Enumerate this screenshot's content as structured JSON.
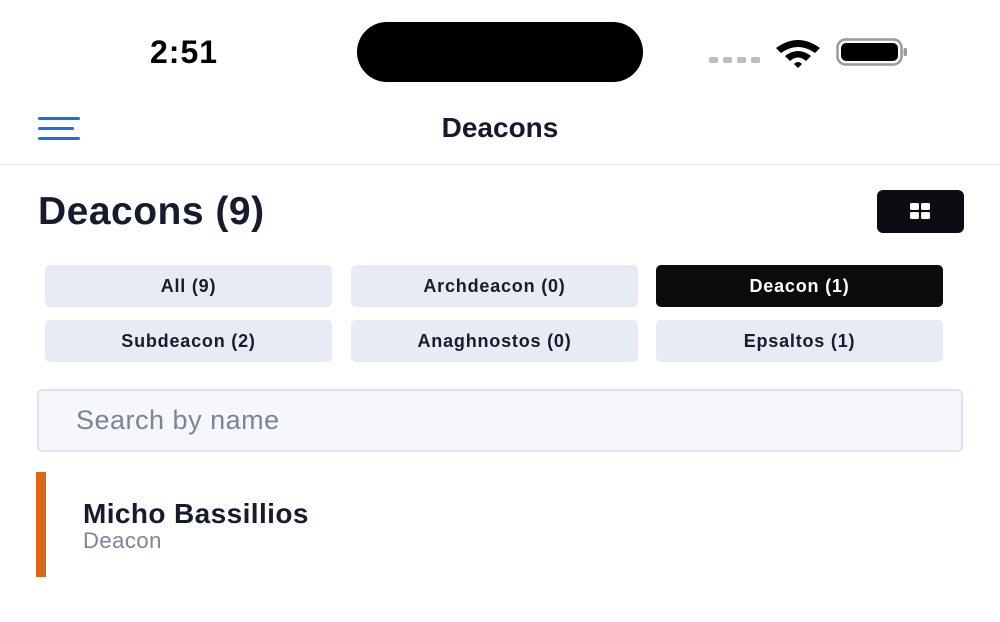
{
  "status_bar": {
    "time": "2:51"
  },
  "nav": {
    "title": "Deacons",
    "menu_icon": "hamburger-menu-icon"
  },
  "header": {
    "title": "Deacons (9)",
    "view_toggle_icon": "grid-view-icon"
  },
  "filters": [
    {
      "label": "All (9)",
      "active": false
    },
    {
      "label": "Archdeacon (0)",
      "active": false
    },
    {
      "label": "Deacon (1)",
      "active": true
    },
    {
      "label": "Subdeacon (2)",
      "active": false
    },
    {
      "label": "Anaghnostos (0)",
      "active": false
    },
    {
      "label": "Epsaltos (1)",
      "active": false
    }
  ],
  "search": {
    "placeholder": "Search by name",
    "value": ""
  },
  "people": [
    {
      "name": "Micho Bassillios",
      "role": "Deacon",
      "accent_color": "#dd6518"
    }
  ],
  "colors": {
    "accent_blue": "#1f6ee0",
    "active_chip": "#0b0b0b",
    "chip_bg": "#e7ebf3",
    "list_accent": "#dd6518"
  }
}
